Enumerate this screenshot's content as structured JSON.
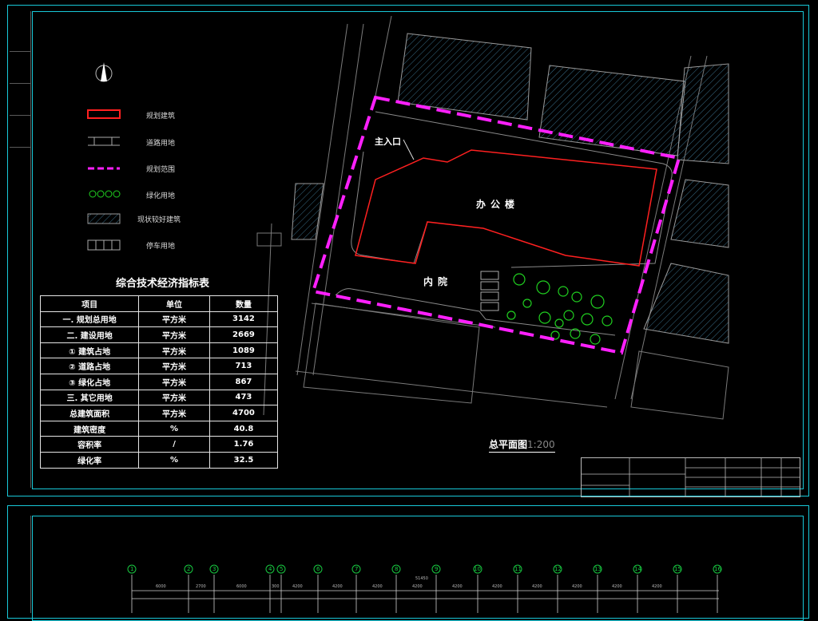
{
  "legend": [
    {
      "label": "规划建筑",
      "icon": "planned-building-swatch",
      "color": "#ff2020"
    },
    {
      "label": "道路用地",
      "icon": "road-swatch",
      "color": "#aaaaaa"
    },
    {
      "label": "规划范围",
      "icon": "boundary-swatch",
      "color": "#ff20ff"
    },
    {
      "label": "绿化用地",
      "icon": "green-swatch",
      "color": "#20d020"
    },
    {
      "label": "现状较好建筑",
      "icon": "existing-building-swatch",
      "color": "#3a7fa0"
    },
    {
      "label": "停车用地",
      "icon": "parking-swatch",
      "color": "#aaaaaa"
    }
  ],
  "table": {
    "title": "综合技术经济指标表",
    "headers": [
      "项目",
      "单位",
      "数量"
    ],
    "rows": [
      [
        "一. 规划总用地",
        "平方米",
        "3142"
      ],
      [
        "二. 建设用地",
        "平方米",
        "2669"
      ],
      [
        "① 建筑占地",
        "平方米",
        "1089"
      ],
      [
        "② 道路占地",
        "平方米",
        "713"
      ],
      [
        "③ 绿化占地",
        "平方米",
        "867"
      ],
      [
        "三. 其它用地",
        "平方米",
        "473"
      ],
      [
        "总建筑面积",
        "平方米",
        "4700"
      ],
      [
        "建筑密度",
        "%",
        "40.8"
      ],
      [
        "容积率",
        "/",
        "1.76"
      ],
      [
        "绿化率",
        "%",
        "32.5"
      ]
    ]
  },
  "plan": {
    "title": "总平面图",
    "scale": "1:200",
    "entrance": "主入口",
    "office": "办公楼",
    "courtyard": "内院"
  },
  "dims": {
    "total": "51450",
    "segments": [
      "6000",
      "2700",
      "6000",
      "300",
      "4200",
      "4200",
      "4200",
      "4200",
      "4200",
      "4200",
      "4200",
      "4200",
      "4200",
      "4200"
    ]
  },
  "axes": [
    "1",
    "2",
    "3",
    "4",
    "5",
    "6",
    "7",
    "8",
    "9",
    "10",
    "11",
    "12",
    "13",
    "14",
    "15",
    "16"
  ],
  "colors": {
    "sheet_border": "#18c8d8",
    "planned_building": "#ff2020",
    "boundary": "#ff20ff",
    "green": "#20d020",
    "existing_building": "#3a7fa0"
  }
}
